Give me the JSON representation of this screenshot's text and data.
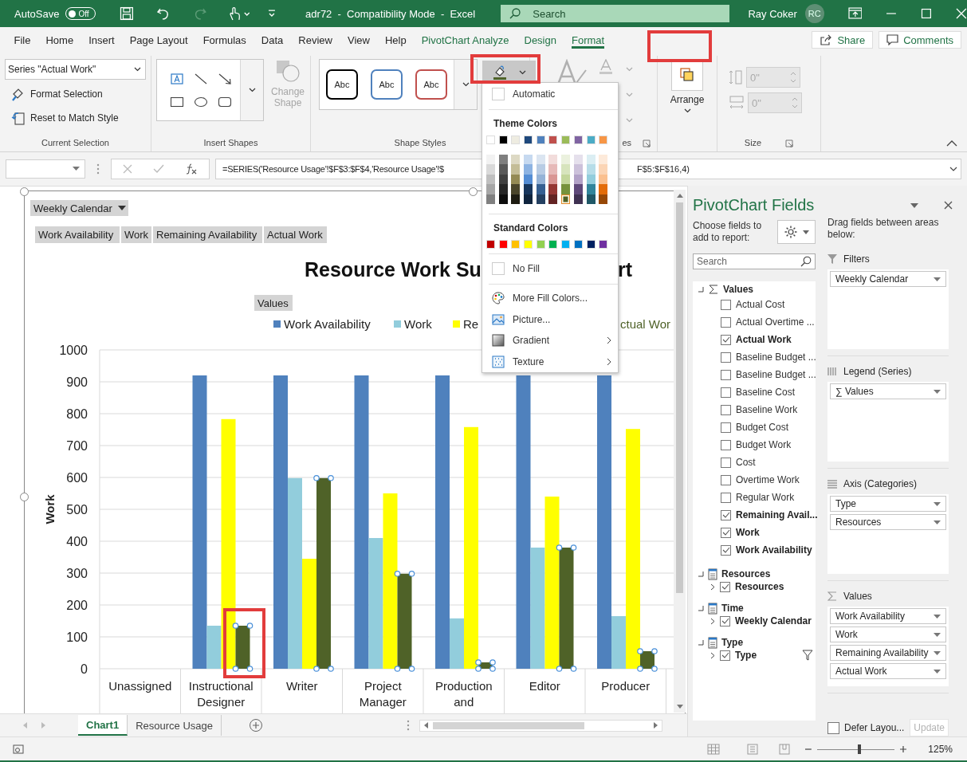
{
  "title_bar": {
    "autosave_label": "AutoSave",
    "autosave": {
      "on": false,
      "label": "Off"
    },
    "document_title": "adr72  -  Compatibility Mode  -  Excel",
    "search_placeholder": "Search",
    "user_name": "Ray Coker",
    "user_initials": "RC"
  },
  "menu_tabs": [
    {
      "label": "File",
      "selected": false,
      "kind": "main"
    },
    {
      "label": "Home",
      "selected": false,
      "kind": "main"
    },
    {
      "label": "Insert",
      "selected": false,
      "kind": "main"
    },
    {
      "label": "Page Layout",
      "selected": false,
      "kind": "main"
    },
    {
      "label": "Formulas",
      "selected": false,
      "kind": "main"
    },
    {
      "label": "Data",
      "selected": false,
      "kind": "main"
    },
    {
      "label": "Review",
      "selected": false,
      "kind": "main"
    },
    {
      "label": "View",
      "selected": false,
      "kind": "main"
    },
    {
      "label": "Help",
      "selected": false,
      "kind": "main"
    },
    {
      "label": "PivotChart Analyze",
      "selected": false,
      "kind": "contextual"
    },
    {
      "label": "Design",
      "selected": false,
      "kind": "contextual"
    },
    {
      "label": "Format",
      "selected": true,
      "kind": "contextual"
    }
  ],
  "share_button": "Share",
  "comments_button": "Comments",
  "ribbon": {
    "current_selection": {
      "dropdown": "Series \"Actual Work\"",
      "format_button": "Format Selection",
      "reset_button": "Reset to Match Style",
      "label": "Current Selection"
    },
    "insert_shapes": {
      "change_shape": "Change Shape",
      "label": "Insert Shapes"
    },
    "shape_styles": {
      "samples": [
        {
          "label": "Abc",
          "color": "#000000"
        },
        {
          "label": "Abc",
          "color": "#4f81bd"
        },
        {
          "label": "Abc",
          "color": "#c0504d"
        }
      ],
      "label": "Shape Styles"
    },
    "wordart": {
      "label_fragment": "es"
    },
    "arrange": {
      "label": "Arrange"
    },
    "size": {
      "height": "0\"",
      "width": "0\"",
      "label": "Size"
    }
  },
  "formula_bar": {
    "formula_left": "=SERIES('Resource Usage'!$F$3:$F$4,'Resource Usage'!$",
    "formula_right": "F$5:$F$16,4)"
  },
  "fill_menu": {
    "automatic": "Automatic",
    "theme_label": "Theme Colors",
    "theme_top": [
      {
        "color": "#ffffff"
      },
      {
        "color": "#000000"
      },
      {
        "color": "#eeece1"
      },
      {
        "color": "#1f497d"
      },
      {
        "color": "#4f81bd"
      },
      {
        "color": "#c0504d"
      },
      {
        "color": "#9bbb59"
      },
      {
        "color": "#8064a2"
      },
      {
        "color": "#4bacc6"
      },
      {
        "color": "#f79646"
      }
    ],
    "theme_shades": [
      [
        {
          "color": "#f2f2f2",
          "selected": false
        },
        {
          "color": "#d9d9d9",
          "selected": false
        },
        {
          "color": "#bfbfbf",
          "selected": false
        },
        {
          "color": "#a6a6a6",
          "selected": false
        },
        {
          "color": "#808080",
          "selected": false
        }
      ],
      [
        {
          "color": "#7f7f7f",
          "selected": false
        },
        {
          "color": "#595959",
          "selected": false
        },
        {
          "color": "#404040",
          "selected": false
        },
        {
          "color": "#262626",
          "selected": false
        },
        {
          "color": "#0d0d0d",
          "selected": false
        }
      ],
      [
        {
          "color": "#ddd9c4",
          "selected": false
        },
        {
          "color": "#c4bd97",
          "selected": false
        },
        {
          "color": "#948a54",
          "selected": false
        },
        {
          "color": "#4a452a",
          "selected": false
        },
        {
          "color": "#1e1c11",
          "selected": false
        }
      ],
      [
        {
          "color": "#c6d9f0",
          "selected": false
        },
        {
          "color": "#8db3e2",
          "selected": false
        },
        {
          "color": "#548dd4",
          "selected": false
        },
        {
          "color": "#17365d",
          "selected": false
        },
        {
          "color": "#0f243e",
          "selected": false
        }
      ],
      [
        {
          "color": "#dbe5f1",
          "selected": false
        },
        {
          "color": "#b8cce4",
          "selected": false
        },
        {
          "color": "#95b3d7",
          "selected": false
        },
        {
          "color": "#366092",
          "selected": false
        },
        {
          "color": "#244061",
          "selected": false
        }
      ],
      [
        {
          "color": "#f2dcdb",
          "selected": false
        },
        {
          "color": "#e6b9b8",
          "selected": false
        },
        {
          "color": "#d99694",
          "selected": false
        },
        {
          "color": "#953734",
          "selected": false
        },
        {
          "color": "#632423",
          "selected": false
        }
      ],
      [
        {
          "color": "#ebf1de",
          "selected": false
        },
        {
          "color": "#d7e4bd",
          "selected": false
        },
        {
          "color": "#c3d69b",
          "selected": false
        },
        {
          "color": "#76923c",
          "selected": false
        },
        {
          "color": "#4f6228",
          "selected": true
        }
      ],
      [
        {
          "color": "#e5e0ec",
          "selected": false
        },
        {
          "color": "#ccc1da",
          "selected": false
        },
        {
          "color": "#b2a2c7",
          "selected": false
        },
        {
          "color": "#5f497a",
          "selected": false
        },
        {
          "color": "#3f3151",
          "selected": false
        }
      ],
      [
        {
          "color": "#dbeef3",
          "selected": false
        },
        {
          "color": "#b7dde8",
          "selected": false
        },
        {
          "color": "#92cddc",
          "selected": false
        },
        {
          "color": "#31859b",
          "selected": false
        },
        {
          "color": "#205867",
          "selected": false
        }
      ],
      [
        {
          "color": "#fdeada",
          "selected": false
        },
        {
          "color": "#fbd5b5",
          "selected": false
        },
        {
          "color": "#fac08f",
          "selected": false
        },
        {
          "color": "#e36c09",
          "selected": false
        },
        {
          "color": "#974806",
          "selected": false
        }
      ]
    ],
    "standard_label": "Standard Colors",
    "standard": [
      {
        "color": "#c00000"
      },
      {
        "color": "#ff0000"
      },
      {
        "color": "#ffc000"
      },
      {
        "color": "#ffff00"
      },
      {
        "color": "#92d050"
      },
      {
        "color": "#00b050"
      },
      {
        "color": "#00b0f0"
      },
      {
        "color": "#0070c0"
      },
      {
        "color": "#002060"
      },
      {
        "color": "#7030a0"
      }
    ],
    "no_fill": "No Fill",
    "items": [
      {
        "label": "More Fill Colors...",
        "submenu": false
      },
      {
        "label": "Picture...",
        "submenu": false
      },
      {
        "label": "Gradient",
        "submenu": true
      },
      {
        "label": "Texture",
        "submenu": true
      }
    ]
  },
  "chart": {
    "filter_button": "Weekly Calendar",
    "value_buttons": [
      "Work Availability",
      "Work",
      "Remaining Availability",
      "Actual Work"
    ],
    "title_parts": [
      "Resource Work Su",
      "rt"
    ],
    "values_button": "Values",
    "chart_data": {
      "type": "bar",
      "ylabel": "Work",
      "grid": true,
      "legend": true,
      "categories": [
        "Unassigned",
        "Instructional Designer",
        "Writer",
        "Project Manager",
        "Production and",
        "Editor",
        "Producer"
      ],
      "series": [
        {
          "name": "Work Availability",
          "color": "#4f81bd",
          "values": [
            null,
            920,
            920,
            920,
            920,
            920,
            920
          ]
        },
        {
          "name": "Work",
          "color": "#92cddc",
          "values": [
            null,
            135,
            598,
            410,
            158,
            380,
            165
          ]
        },
        {
          "name": "Re",
          "color": "#ffff00",
          "values": [
            null,
            783,
            345,
            550,
            758,
            540,
            752
          ]
        },
        {
          "name": "ctual Wor",
          "color": "#4f6228",
          "values": [
            null,
            135,
            598,
            298,
            20,
            380,
            55
          ]
        }
      ],
      "ylim": [
        0,
        1000
      ],
      "yticks": [
        0,
        100,
        200,
        300,
        400,
        500,
        600,
        700,
        800,
        900,
        1000
      ]
    }
  },
  "sheet_tabs": [
    {
      "label": "Chart1",
      "selected": true
    },
    {
      "label": "Resource Usage",
      "selected": false
    }
  ],
  "pivot_pane": {
    "title": "PivotChart Fields",
    "choose_label": "Choose fields to add to report:",
    "search_placeholder": "Search",
    "drag_label": "Drag fields between areas below:",
    "fields": [
      {
        "kind": "values",
        "label": "Values",
        "children": [
          {
            "label": "Actual Cost",
            "checked": false
          },
          {
            "label": "Actual Overtime ...",
            "checked": false
          },
          {
            "label": "Actual Work",
            "checked": true
          },
          {
            "label": "Baseline Budget ...",
            "checked": false
          },
          {
            "label": "Baseline Budget ...",
            "checked": false
          },
          {
            "label": "Baseline Cost",
            "checked": false
          },
          {
            "label": "Baseline Work",
            "checked": false
          },
          {
            "label": "Budget Cost",
            "checked": false
          },
          {
            "label": "Budget Work",
            "checked": false
          },
          {
            "label": "Cost",
            "checked": false
          },
          {
            "label": "Overtime Work",
            "checked": false
          },
          {
            "label": "Regular Work",
            "checked": false
          },
          {
            "label": "Remaining Avail...",
            "checked": true
          },
          {
            "label": "Work",
            "checked": true
          },
          {
            "label": "Work Availability",
            "checked": true
          }
        ]
      },
      {
        "kind": "table",
        "label": "Resources",
        "children": [
          {
            "label": "Resources",
            "checked": true,
            "filtered": false
          }
        ]
      },
      {
        "kind": "table",
        "label": "Time",
        "children": [
          {
            "label": "Weekly Calendar",
            "checked": true,
            "filtered": false
          }
        ]
      },
      {
        "kind": "table",
        "label": "Type",
        "children": [
          {
            "label": "Type",
            "checked": true,
            "filtered": true
          }
        ]
      }
    ],
    "areas": [
      {
        "kind": "filters",
        "label": "Filters",
        "items": [
          "Weekly Calendar"
        ]
      },
      {
        "kind": "legend",
        "label": "Legend (Series)",
        "items": [
          "∑ Values"
        ]
      },
      {
        "kind": "axis",
        "label": "Axis (Categories)",
        "items": [
          "Type",
          "Resources"
        ]
      },
      {
        "kind": "values",
        "label": "Values",
        "items": [
          "Work Availability",
          "Work",
          "Remaining Availability",
          "Actual Work"
        ]
      }
    ],
    "defer": {
      "label": "Defer Layou...",
      "checked": false
    },
    "update_button": {
      "label": "Update",
      "disabled": true
    }
  },
  "status_bar": {
    "zoom_label": "125%",
    "zoom": {
      "level": 0.54
    }
  }
}
